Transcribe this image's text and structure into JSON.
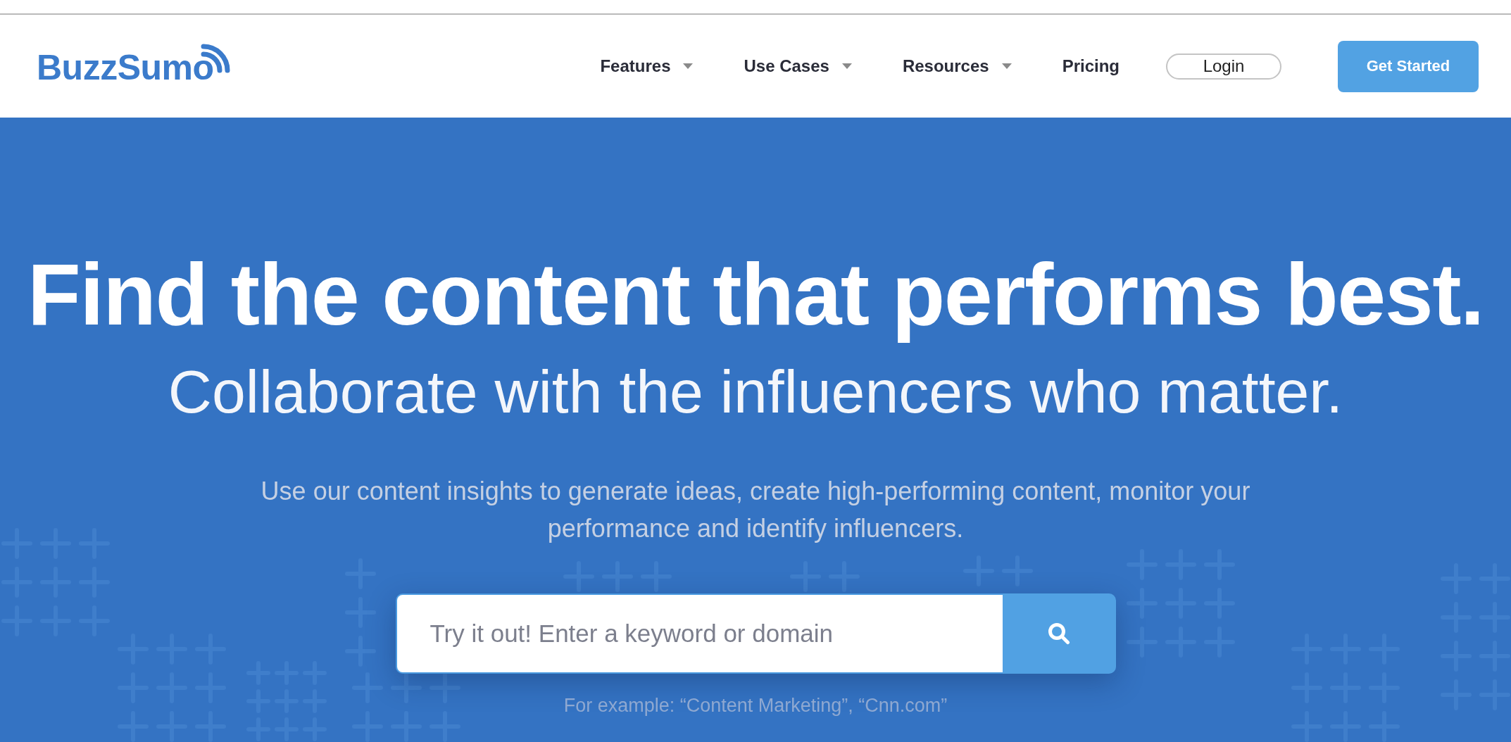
{
  "header": {
    "logo": {
      "text": "BuzzSumo"
    },
    "nav": [
      {
        "label": "Features",
        "kind": "dropdown"
      },
      {
        "label": "Use Cases",
        "kind": "dropdown"
      },
      {
        "label": "Resources",
        "kind": "dropdown"
      },
      {
        "label": "Pricing",
        "kind": "link"
      },
      {
        "label": "Login",
        "kind": "outlined"
      },
      {
        "label": "Get Started",
        "kind": "primary"
      }
    ]
  },
  "hero": {
    "headline": "Find the content that performs best.",
    "subheadline": "Collaborate with the influencers who matter.",
    "description": "Use our content insights to generate ideas, create high-performing content, monitor your performance and identify influencers.",
    "search": {
      "placeholder": "Try it out! Enter a keyword or domain"
    },
    "example": "For example: “Content Marketing”, “Cnn.com”"
  }
}
